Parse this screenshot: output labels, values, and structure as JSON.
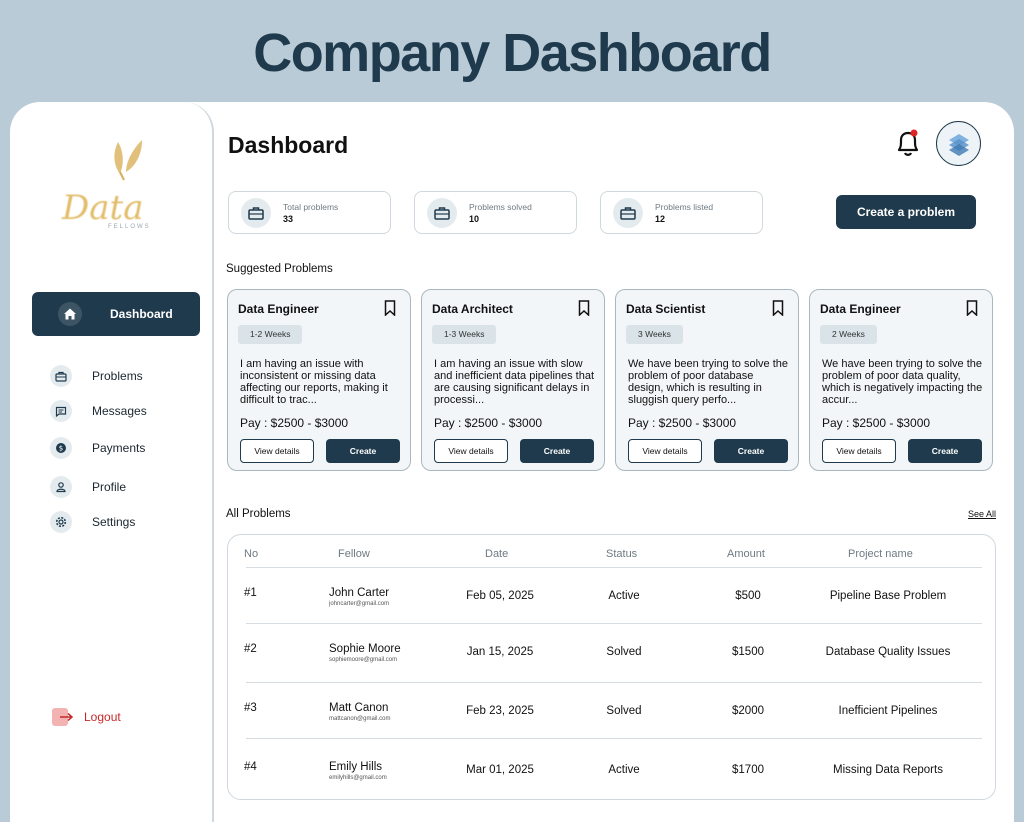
{
  "page_title": "Company Dashboard",
  "brand": {
    "logo_text": "Data",
    "logo_sub": "FELLOWS",
    "logo_color": "#e2bd6a"
  },
  "colors": {
    "primary": "#1e3a4c",
    "bg": "#b9cbd6",
    "danger": "#c42a2a",
    "notification": "#e02424"
  },
  "sidebar": {
    "active": {
      "label": "Dashboard",
      "icon": "home-icon"
    },
    "items": [
      {
        "label": "Problems",
        "icon": "briefcase-icon"
      },
      {
        "label": "Messages",
        "icon": "message-icon"
      },
      {
        "label": "Payments",
        "icon": "dollar-icon"
      },
      {
        "label": "Profile",
        "icon": "user-icon"
      },
      {
        "label": "Settings",
        "icon": "gear-icon"
      }
    ],
    "logout": "Logout"
  },
  "header": {
    "title": "Dashboard"
  },
  "stats": [
    {
      "label": "Total problems",
      "value": "33"
    },
    {
      "label": "Problems solved",
      "value": "10"
    },
    {
      "label": "Problems listed",
      "value": "12"
    }
  ],
  "create_button": "Create a problem",
  "suggested": {
    "title": "Suggested Problems",
    "cards": [
      {
        "role": "Data Engineer",
        "duration": "1-2 Weeks",
        "desc": "I am having an issue with inconsistent or missing data affecting our reports, making it difficult to trac...",
        "pay": "Pay : $2500  - $3000",
        "view": "View details",
        "create": "Create"
      },
      {
        "role": "Data Architect",
        "duration": "1-3 Weeks",
        "desc": "I am having an issue with slow and inefficient data pipelines that are causing significant delays in processi...",
        "pay": "Pay : $2500  - $3000",
        "view": "View details",
        "create": "Create"
      },
      {
        "role": "Data Scientist",
        "duration": "3 Weeks",
        "desc": "We have been trying to solve the problem of poor database design, which is resulting in sluggish query perfo...",
        "pay": "Pay : $2500  - $3000",
        "view": "View details",
        "create": "Create"
      },
      {
        "role": "Data Engineer",
        "duration": "2 Weeks",
        "desc": "We have been trying to solve the problem of poor data quality, which is negatively impacting the accur...",
        "pay": "Pay : $2500  - $3000",
        "view": "View details",
        "create": "Create"
      }
    ]
  },
  "all_problems": {
    "title": "All Problems",
    "see_all": "See All",
    "columns": [
      "No",
      "Fellow",
      "Date",
      "Status",
      "Amount",
      "Project name"
    ],
    "rows": [
      {
        "no": "#1",
        "name": "John Carter",
        "email": "johncarter@gmail.com",
        "date": "Feb 05, 2025",
        "status": "Active",
        "amount": "$500",
        "project": "Pipeline Base Problem"
      },
      {
        "no": "#2",
        "name": "Sophie Moore",
        "email": "sophiemoore@gmail.com",
        "date": "Jan 15, 2025",
        "status": "Solved",
        "amount": "$1500",
        "project": "Database Quality Issues"
      },
      {
        "no": "#3",
        "name": "Matt Canon",
        "email": "mattcanon@gmail.com",
        "date": "Feb 23, 2025",
        "status": "Solved",
        "amount": "$2000",
        "project": "Inefficient Pipelines"
      },
      {
        "no": "#4",
        "name": "Emily Hills",
        "email": "emilyhills@gmail.com",
        "date": "Mar 01, 2025",
        "status": "Active",
        "amount": "$1700",
        "project": "Missing Data Reports"
      }
    ]
  }
}
